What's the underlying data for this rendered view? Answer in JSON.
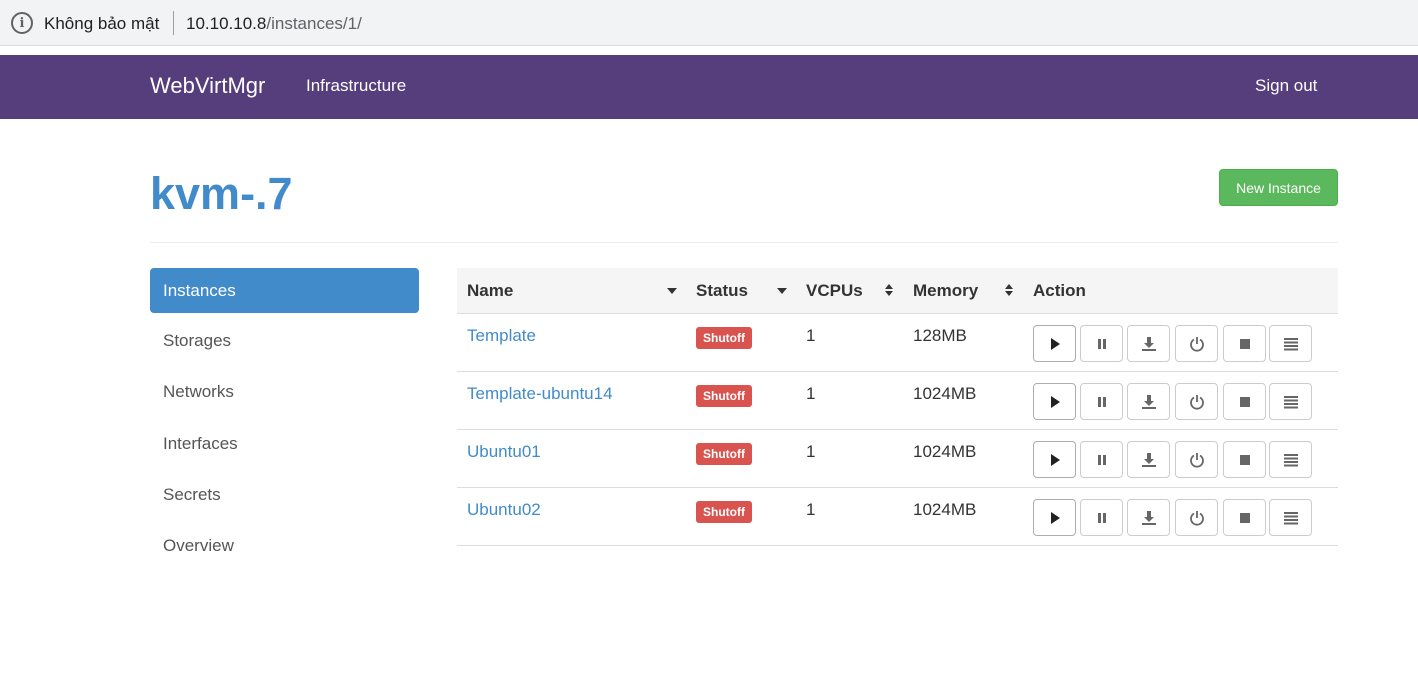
{
  "browser": {
    "security_label": "Không bảo mật",
    "url_host": "10.10.10.8",
    "url_path": "/instances/1/"
  },
  "navbar": {
    "brand": "WebVirtMgr",
    "links": [
      "Infrastructure"
    ],
    "signout": "Sign out"
  },
  "page": {
    "title": "kvm-.7",
    "new_instance_label": "New Instance"
  },
  "sidebar": {
    "items": [
      {
        "label": "Instances",
        "active": true
      },
      {
        "label": "Storages",
        "active": false
      },
      {
        "label": "Networks",
        "active": false
      },
      {
        "label": "Interfaces",
        "active": false
      },
      {
        "label": "Secrets",
        "active": false
      },
      {
        "label": "Overview",
        "active": false
      }
    ]
  },
  "table": {
    "columns": [
      "Name",
      "Status",
      "VCPUs",
      "Memory",
      "Action"
    ],
    "rows": [
      {
        "name": "Template",
        "status": "Shutoff",
        "vcpus": "1",
        "memory": "128MB"
      },
      {
        "name": "Template-ubuntu14",
        "status": "Shutoff",
        "vcpus": "1",
        "memory": "1024MB"
      },
      {
        "name": "Ubuntu01",
        "status": "Shutoff",
        "vcpus": "1",
        "memory": "1024MB"
      },
      {
        "name": "Ubuntu02",
        "status": "Shutoff",
        "vcpus": "1",
        "memory": "1024MB"
      }
    ],
    "actions": [
      "play-icon",
      "pause-icon",
      "download-icon",
      "power-icon",
      "stop-icon",
      "list-icon"
    ]
  },
  "colors": {
    "navbar": "#563d7c",
    "link": "#428bca",
    "success": "#5cb85c",
    "danger": "#d9534f"
  }
}
